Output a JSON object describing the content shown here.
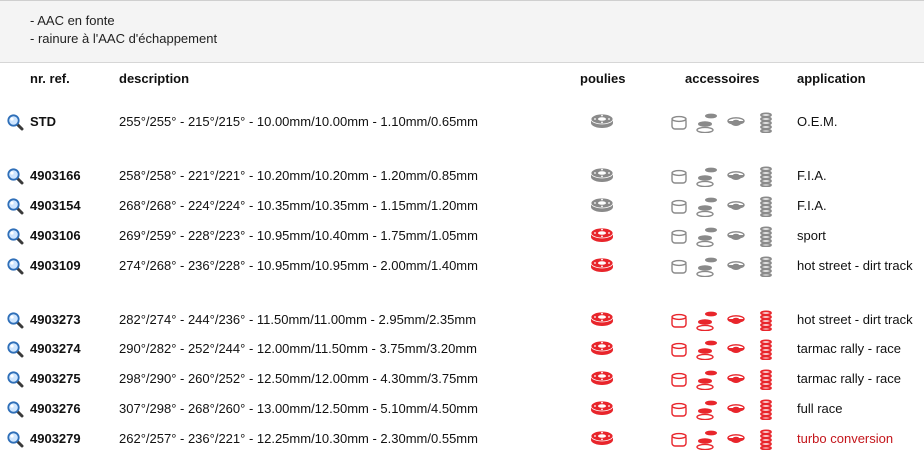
{
  "notes": [
    "- AAC en fonte",
    "- rainure à l'AAC d'échappement"
  ],
  "headers": {
    "ref": "nr. ref.",
    "description": "description",
    "pulleys": "poulies",
    "accessories": "accessoires",
    "application": "application"
  },
  "colors": {
    "grey_icon": "#8a8a8a",
    "red_icon": "#e8252b",
    "red_text": "#c4161c"
  },
  "rows": [
    {
      "ref": "STD",
      "desc": "255°/255° - 215°/215° - 10.00mm/10.00mm - 1.10mm/0.65mm",
      "pulley": "grey",
      "acc": "grey",
      "app": "O.E.M.",
      "app_red": false
    },
    {
      "ref": "4903166",
      "desc": "258°/258° - 221°/221° - 10.20mm/10.20mm - 1.20mm/0.85mm",
      "pulley": "grey",
      "acc": "grey",
      "app": "F.I.A.",
      "app_red": false
    },
    {
      "ref": "4903154",
      "desc": "268°/268° - 224°/224° - 10.35mm/10.35mm - 1.15mm/1.20mm",
      "pulley": "grey",
      "acc": "grey",
      "app": "F.I.A.",
      "app_red": false
    },
    {
      "ref": "4903106",
      "desc": "269°/259° - 228°/223° - 10.95mm/10.40mm - 1.75mm/1.05mm",
      "pulley": "red",
      "acc": "grey",
      "app": "sport",
      "app_red": false
    },
    {
      "ref": "4903109",
      "desc": "274°/268° - 236°/228° - 10.95mm/10.95mm - 2.00mm/1.40mm",
      "pulley": "red",
      "acc": "grey",
      "app": "hot street - dirt track",
      "app_red": false
    },
    {
      "ref": "4903273",
      "desc": "282°/274° - 244°/236° - 11.50mm/11.00mm - 2.95mm/2.35mm",
      "pulley": "red",
      "acc": "red",
      "app": "hot street - dirt track",
      "app_red": false
    },
    {
      "ref": "4903274",
      "desc": "290°/282° - 252°/244° - 12.00mm/11.50mm - 3.75mm/3.20mm",
      "pulley": "red",
      "acc": "red",
      "app": "tarmac rally - race",
      "app_red": false
    },
    {
      "ref": "4903275",
      "desc": "298°/290° - 260°/252° - 12.50mm/12.00mm - 4.30mm/3.75mm",
      "pulley": "red",
      "acc": "red",
      "app": "tarmac rally - race",
      "app_red": false
    },
    {
      "ref": "4903276",
      "desc": "307°/298° - 268°/260° - 13.00mm/12.50mm - 5.10mm/4.50mm",
      "pulley": "red",
      "acc": "red",
      "app": "full race",
      "app_red": false
    },
    {
      "ref": "4903279",
      "desc": "262°/257° - 236°/221° - 12.25mm/10.30mm - 2.30mm/0.55mm",
      "pulley": "red",
      "acc": "red",
      "app": "turbo conversion",
      "app_red": true
    }
  ]
}
